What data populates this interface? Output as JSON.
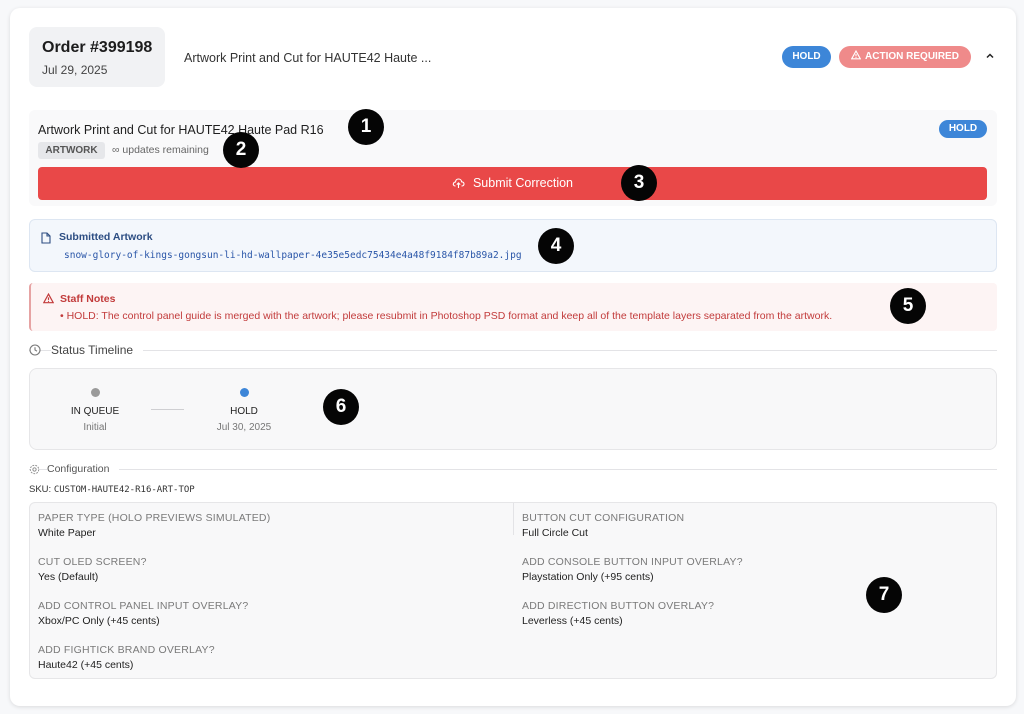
{
  "order": {
    "number": "Order #399198",
    "date": "Jul 29, 2025",
    "title_truncated": "Artwork Print and Cut for HAUTE42 Haute ...",
    "badges": {
      "hold": "HOLD",
      "action_required": "ACTION REQUIRED"
    }
  },
  "item": {
    "title": "Artwork Print and Cut for HAUTE42 Haute Pad R16",
    "tag": "ARTWORK",
    "updates": "∞ updates remaining",
    "status": "HOLD",
    "submit_label": "Submit Correction"
  },
  "artwork": {
    "label": "Submitted Artwork",
    "filename": "snow-glory-of-kings-gongsun-li-hd-wallpaper-4e35e5edc75434e4a48f9184f87b89a2.jpg"
  },
  "notes": {
    "label": "Staff Notes",
    "text": "• HOLD: The control panel guide is merged with the artwork; please resubmit in Photoshop PSD format and keep all of the template layers separated from the artwork."
  },
  "timeline": {
    "label": "Status Timeline",
    "steps": [
      {
        "label": "IN QUEUE",
        "sub": "Initial",
        "color": "#9a9a9a"
      },
      {
        "label": "HOLD",
        "sub": "Jul 30, 2025",
        "color": "#3d86d8"
      }
    ]
  },
  "configuration": {
    "label": "Configuration",
    "sku_label": "SKU:",
    "sku": "CUSTOM-HAUTE42-R16-ART-TOP",
    "options": [
      {
        "label": "PAPER TYPE (HOLO PREVIEWS SIMULATED)",
        "value": "White Paper"
      },
      {
        "label": "BUTTON CUT CONFIGURATION",
        "value": "Full Circle Cut"
      },
      {
        "label": "CUT OLED SCREEN?",
        "value": "Yes (Default)"
      },
      {
        "label": "ADD CONSOLE BUTTON INPUT OVERLAY?",
        "value": "Playstation Only (+95 cents)"
      },
      {
        "label": "ADD CONTROL PANEL INPUT OVERLAY?",
        "value": "Xbox/PC Only (+45 cents)"
      },
      {
        "label": "ADD DIRECTION BUTTON OVERLAY?",
        "value": "Leverless (+45 cents)"
      },
      {
        "label": "ADD FIGHTICK BRAND OVERLAY?",
        "value": "Haute42 (+45 cents)"
      }
    ]
  },
  "markers": [
    "1",
    "2",
    "3",
    "4",
    "5",
    "6",
    "7"
  ],
  "colors": {
    "hold": "#3d86d8",
    "action": "#ef8a8a",
    "submit": "#e94848",
    "notes": "#c23b3b"
  }
}
